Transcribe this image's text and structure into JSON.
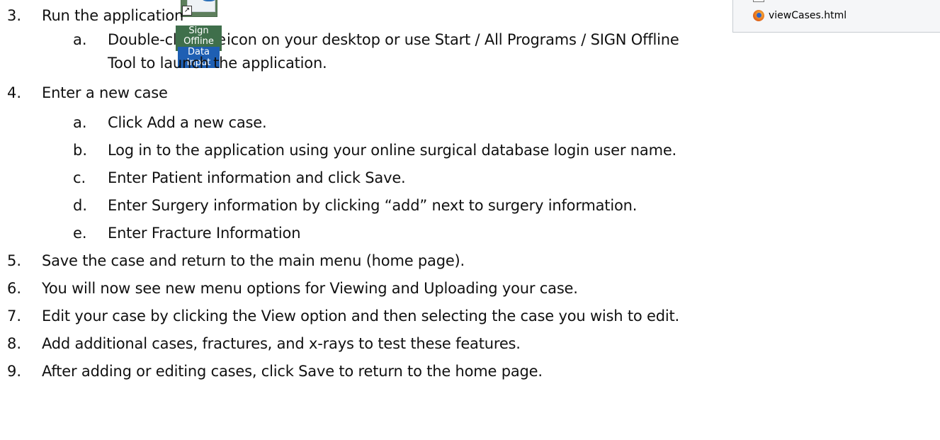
{
  "file_panel": {
    "file_name": "viewCases.html",
    "file_icon": "firefox-icon"
  },
  "desktop_icon": {
    "label_line1": "Sign Offline",
    "label_line2": "Data Input",
    "shortcut_glyph": "↗"
  },
  "steps": [
    {
      "num": "3.",
      "text": "Run the application"
    },
    {
      "num": "a.",
      "text_before_icon": "Double-click the",
      "text_after_icon": "icon on your desktop or use Start / All Programs / SIGN Offline",
      "text_cont": "Tool to launch the application."
    },
    {
      "num": "4.",
      "text": "Enter a new case"
    },
    {
      "num": "a.",
      "text": "Click Add a new case."
    },
    {
      "num": "b.",
      "text": "Log in to the application using your online surgical database login user name."
    },
    {
      "num": "c.",
      "text": "Enter Patient information and click Save."
    },
    {
      "num": "d.",
      "text": "Enter Surgery information by clicking “add” next to surgery information."
    },
    {
      "num": "e.",
      "text": "Enter Fracture Information"
    },
    {
      "num": "5.",
      "text": "Save the case and return to the main menu (home page)."
    },
    {
      "num": "6.",
      "text": "You will now see new menu options for Viewing and Uploading your case."
    },
    {
      "num": "7.",
      "text": "Edit your case by clicking the View option and then selecting the case you wish to edit."
    },
    {
      "num": "8.",
      "text": "Add additional cases, fractures, and x-rays to test these features."
    },
    {
      "num": "9.",
      "text": "After adding or editing cases, click Save to return to the home page."
    }
  ]
}
